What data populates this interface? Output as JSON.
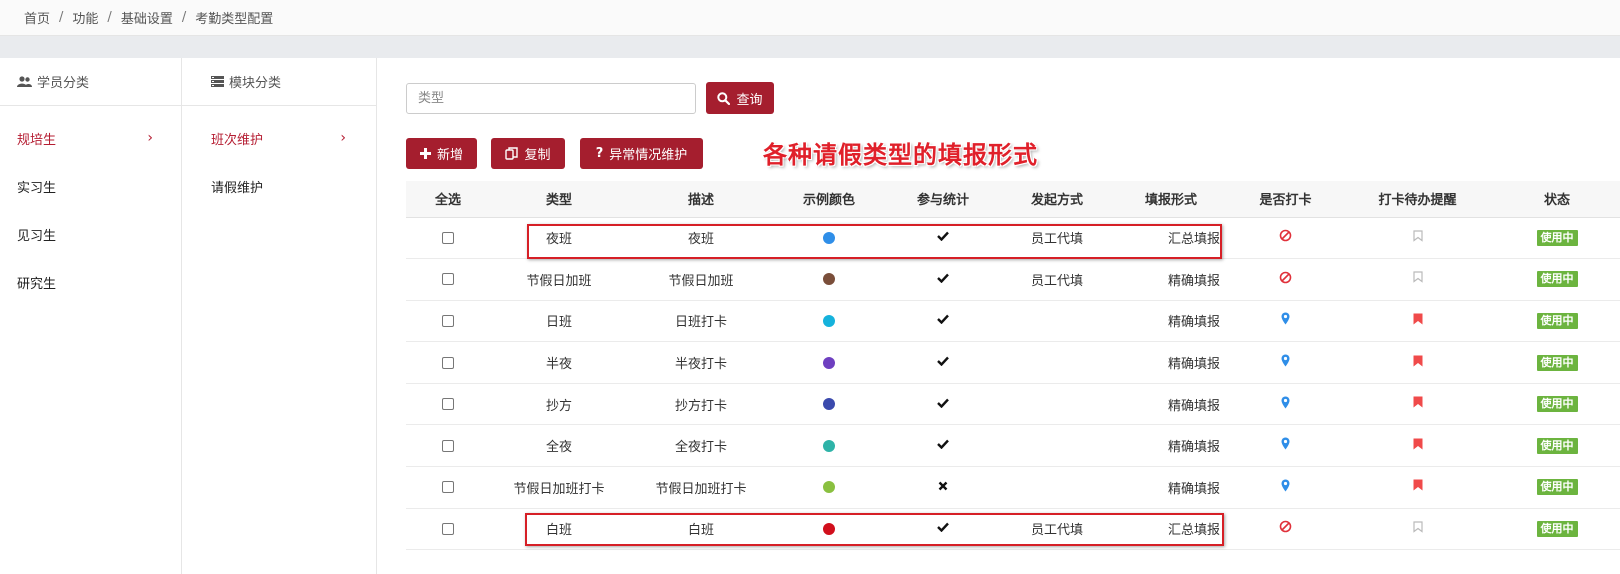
{
  "breadcrumb": [
    "首页",
    "功能",
    "基础设置",
    "考勤类型配置"
  ],
  "panel_student": {
    "title": "学员分类",
    "items": [
      {
        "label": "规培生",
        "active": true
      },
      {
        "label": "实习生",
        "active": false
      },
      {
        "label": "见习生",
        "active": false
      },
      {
        "label": "研究生",
        "active": false
      }
    ]
  },
  "panel_module": {
    "title": "模块分类",
    "items": [
      {
        "label": "班次维护",
        "active": true
      },
      {
        "label": "请假维护",
        "active": false
      }
    ]
  },
  "search": {
    "placeholder": "类型",
    "button_label": "查询"
  },
  "toolbar": {
    "add_label": "新增",
    "copy_label": "复制",
    "exception_label": "异常情况维护"
  },
  "annotation": "各种请假类型的填报形式",
  "table": {
    "headers": [
      "全选",
      "类型",
      "描述",
      "示例颜色",
      "参与统计",
      "发起方式",
      "填报形式",
      "是否打卡",
      "打卡待办提醒",
      "状态"
    ],
    "rows": [
      {
        "type": "夜班",
        "desc": "夜班",
        "color": "#2f8ee8",
        "stat": true,
        "initiate": "员工代填",
        "fill": "汇总填报",
        "clock": "ban",
        "remind": false,
        "status": "使用中"
      },
      {
        "type": "节假日加班",
        "desc": "节假日加班",
        "color": "#7a4e3a",
        "stat": true,
        "initiate": "员工代填",
        "fill": "精确填报",
        "clock": "ban",
        "remind": false,
        "status": "使用中"
      },
      {
        "type": "日班",
        "desc": "日班打卡",
        "color": "#15b2dc",
        "stat": true,
        "initiate": "",
        "fill": "精确填报",
        "clock": "pin",
        "remind": true,
        "status": "使用中"
      },
      {
        "type": "半夜",
        "desc": "半夜打卡",
        "color": "#6e3fc0",
        "stat": true,
        "initiate": "",
        "fill": "精确填报",
        "clock": "pin",
        "remind": true,
        "status": "使用中"
      },
      {
        "type": "抄方",
        "desc": "抄方打卡",
        "color": "#3b4aad",
        "stat": true,
        "initiate": "",
        "fill": "精确填报",
        "clock": "pin",
        "remind": true,
        "status": "使用中"
      },
      {
        "type": "全夜",
        "desc": "全夜打卡",
        "color": "#2eb3a8",
        "stat": true,
        "initiate": "",
        "fill": "精确填报",
        "clock": "pin",
        "remind": true,
        "status": "使用中"
      },
      {
        "type": "节假日加班打卡",
        "desc": "节假日加班打卡",
        "color": "#8ac040",
        "stat": false,
        "initiate": "",
        "fill": "精确填报",
        "clock": "pin",
        "remind": true,
        "status": "使用中"
      },
      {
        "type": "白班",
        "desc": "白班",
        "color": "#d10f1c",
        "stat": true,
        "initiate": "员工代填",
        "fill": "汇总填报",
        "clock": "ban",
        "remind": false,
        "status": "使用中"
      }
    ]
  },
  "colors": {
    "primary": "#a51e2e",
    "active_menu": "#b51d32",
    "badge": "#6cb43f",
    "annotation": "#e0202a",
    "pin": "#2f8ee8",
    "ban": "#e0303a",
    "bookmark_active": "#f04a4a",
    "bookmark_inactive": "#bbbbbb"
  }
}
